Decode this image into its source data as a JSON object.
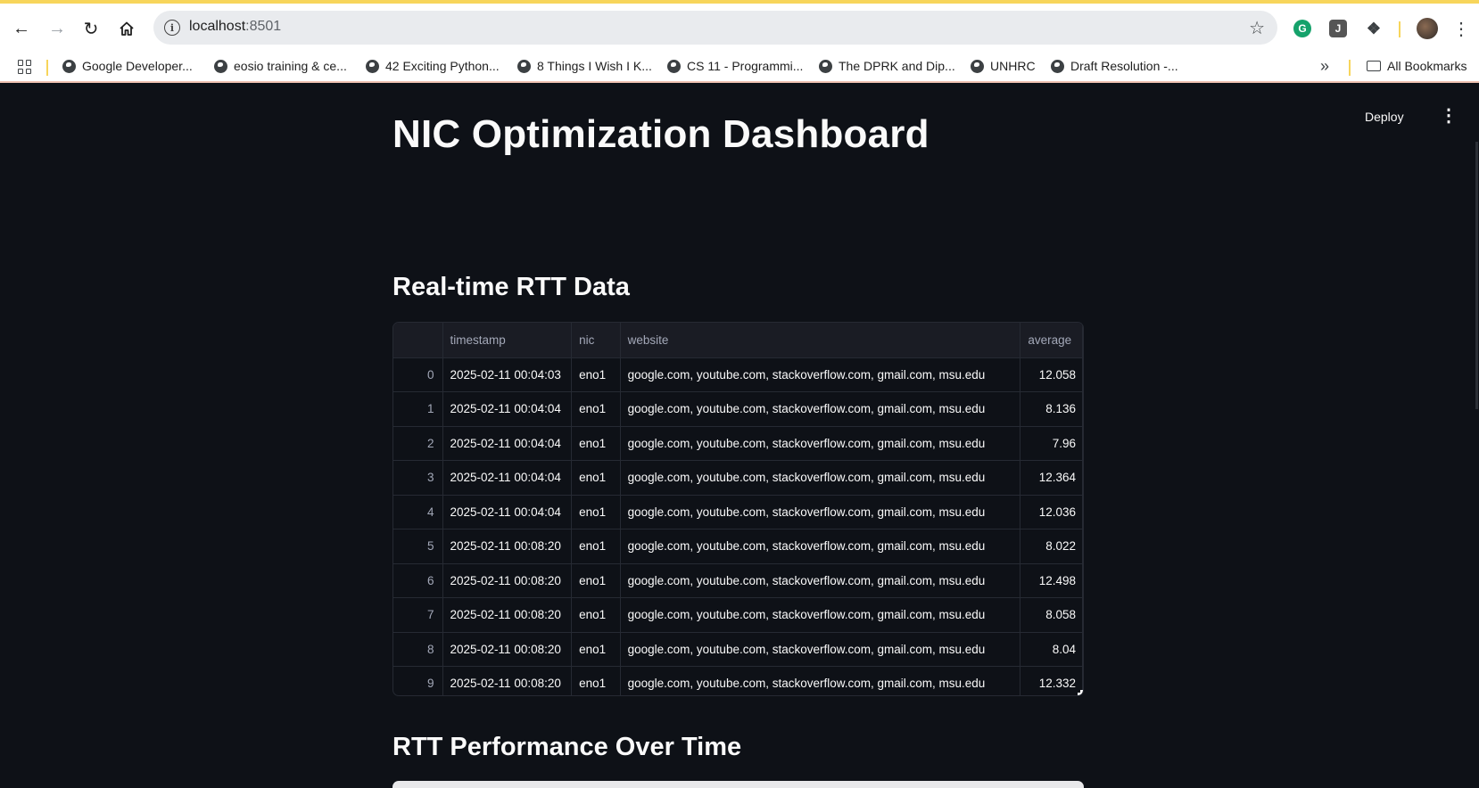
{
  "browser": {
    "url_host": "localhost",
    "url_port": ":8501",
    "bookmarks": [
      "Google Developer...",
      "eosio training & ce...",
      "42 Exciting Python...",
      "8 Things I Wish I K...",
      "CS 11 - Programmi...",
      "The DPRK and Dip...",
      "UNHRC",
      "Draft Resolution -..."
    ],
    "all_bookmarks": "All Bookmarks",
    "ext_g": "G",
    "ext_j": "J"
  },
  "app": {
    "deploy_label": "Deploy",
    "title": "NIC Optimization Dashboard",
    "section_table": "Real-time RTT Data",
    "section_chart": "RTT Performance Over Time"
  },
  "table": {
    "columns": [
      "",
      "timestamp",
      "nic",
      "website",
      "average"
    ],
    "rows": [
      [
        "0",
        "2025-02-11 00:04:03",
        "eno1",
        "google.com, youtube.com, stackoverflow.com, gmail.com, msu.edu",
        "12.058"
      ],
      [
        "1",
        "2025-02-11 00:04:04",
        "eno1",
        "google.com, youtube.com, stackoverflow.com, gmail.com, msu.edu",
        "8.136"
      ],
      [
        "2",
        "2025-02-11 00:04:04",
        "eno1",
        "google.com, youtube.com, stackoverflow.com, gmail.com, msu.edu",
        "7.96"
      ],
      [
        "3",
        "2025-02-11 00:04:04",
        "eno1",
        "google.com, youtube.com, stackoverflow.com, gmail.com, msu.edu",
        "12.364"
      ],
      [
        "4",
        "2025-02-11 00:04:04",
        "eno1",
        "google.com, youtube.com, stackoverflow.com, gmail.com, msu.edu",
        "12.036"
      ],
      [
        "5",
        "2025-02-11 00:08:20",
        "eno1",
        "google.com, youtube.com, stackoverflow.com, gmail.com, msu.edu",
        "8.022"
      ],
      [
        "6",
        "2025-02-11 00:08:20",
        "eno1",
        "google.com, youtube.com, stackoverflow.com, gmail.com, msu.edu",
        "12.498"
      ],
      [
        "7",
        "2025-02-11 00:08:20",
        "eno1",
        "google.com, youtube.com, stackoverflow.com, gmail.com, msu.edu",
        "8.058"
      ],
      [
        "8",
        "2025-02-11 00:08:20",
        "eno1",
        "google.com, youtube.com, stackoverflow.com, gmail.com, msu.edu",
        "8.04"
      ],
      [
        "9",
        "2025-02-11 00:08:20",
        "eno1",
        "google.com, youtube.com, stackoverflow.com, gmail.com, msu.edu",
        "12.332"
      ]
    ]
  },
  "colors": {
    "app_background": "#0e1117",
    "header_background": "#1a1c24",
    "text": "#fafafa",
    "muted_text": "#a3a8b8",
    "accent_bar": "#f7d55b"
  },
  "icons": {
    "back": "arrow-left-icon",
    "forward": "arrow-right-icon",
    "reload": "reload-icon",
    "home": "home-icon",
    "site_info": "info-icon",
    "bookmark_star": "star-icon",
    "apps": "apps-grid-icon",
    "bookmark_favicon": "globe-icon",
    "more_bookmarks": "double-chevron-icon",
    "folder": "folder-icon",
    "app_menu": "kebab-menu-icon"
  }
}
